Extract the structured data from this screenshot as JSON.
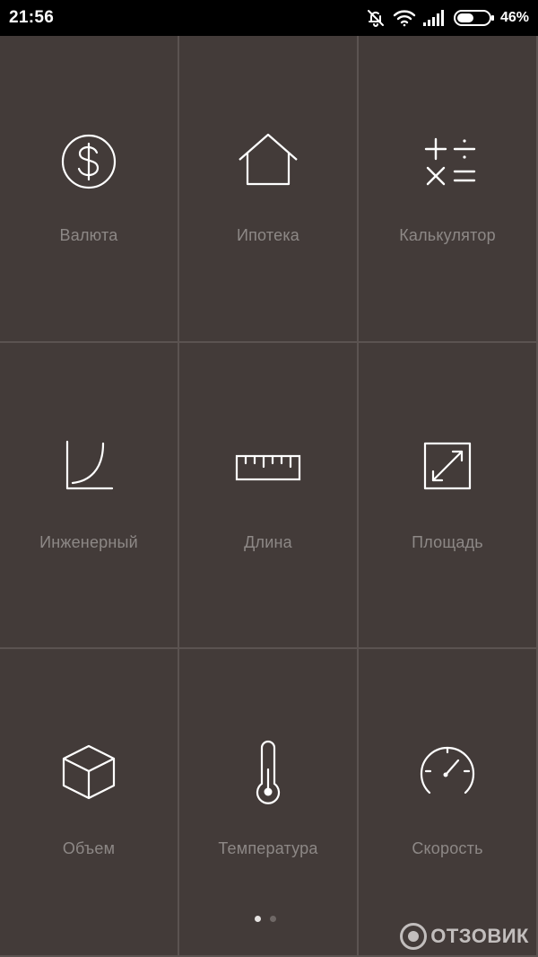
{
  "status_bar": {
    "time": "21:56",
    "battery_percent": "46%",
    "icons": [
      "mute-icon",
      "wifi-icon",
      "signal-icon",
      "battery-icon"
    ]
  },
  "converters": [
    {
      "label": "Валюта",
      "icon": "dollar-icon"
    },
    {
      "label": "Ипотека",
      "icon": "house-icon"
    },
    {
      "label": "Калькулятор",
      "icon": "calculator-icon"
    },
    {
      "label": "Инженерный",
      "icon": "curve-graph-icon"
    },
    {
      "label": "Длина",
      "icon": "ruler-icon"
    },
    {
      "label": "Площадь",
      "icon": "area-resize-icon"
    },
    {
      "label": "Объем",
      "icon": "cube-icon"
    },
    {
      "label": "Температура",
      "icon": "thermometer-icon"
    },
    {
      "label": "Скорость",
      "icon": "speedometer-icon"
    }
  ],
  "pager": {
    "pages": 2,
    "current": 1
  },
  "watermark": {
    "text": "ОТЗОВИК"
  },
  "colors": {
    "background": "#3a3230",
    "tile": "#433b39",
    "tile_border": "#5b5351",
    "icon": "#ffffff",
    "label": "#8d8886"
  }
}
